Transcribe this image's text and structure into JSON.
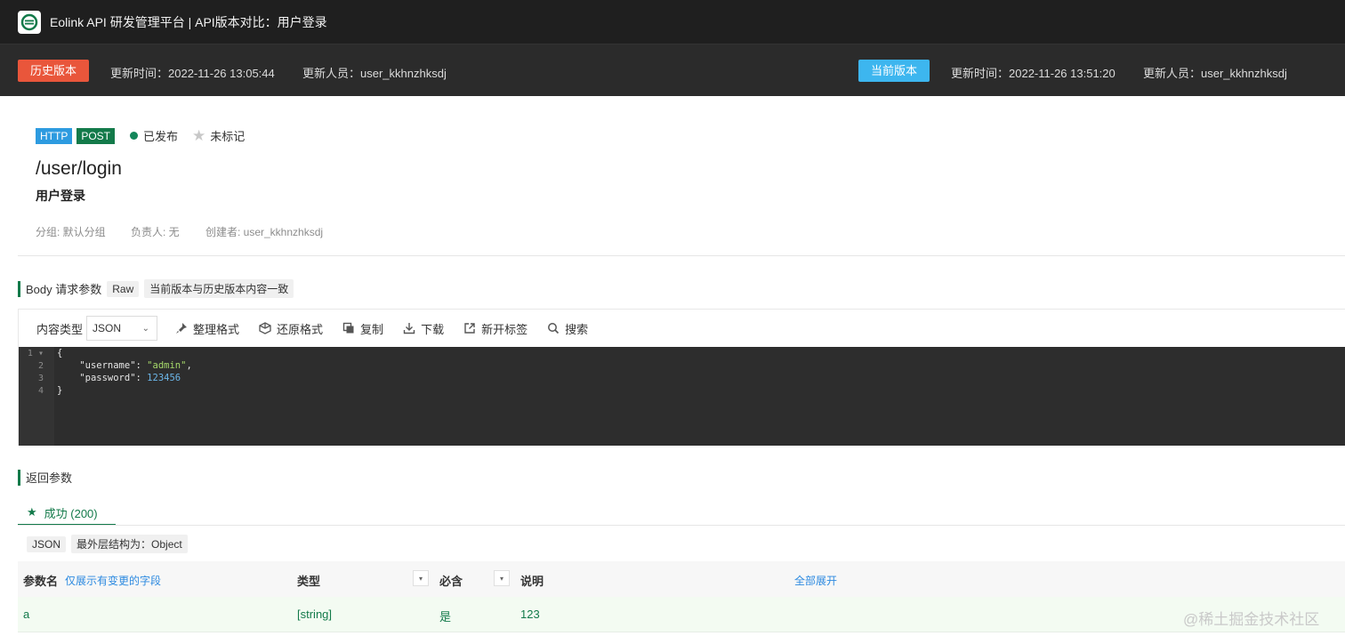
{
  "window": {
    "title": "Eolink API 研发管理平台 | API版本对比：用户登录"
  },
  "compare": {
    "history": {
      "tag": "历史版本",
      "updated_time": "更新时间：2022-11-26 13:05:44",
      "updated_by": "更新人员：user_kkhnzhksdj"
    },
    "current": {
      "tag": "当前版本",
      "updated_time": "更新时间：2022-11-26 13:51:20",
      "updated_by": "更新人员：user_kkhnzhksdj"
    }
  },
  "api": {
    "protocol": "HTTP",
    "method": "POST",
    "status": "已发布",
    "mark": "未标记",
    "path": "/user/login",
    "name": "用户登录",
    "group": "分组: 默认分组",
    "owner": "负责人: 无",
    "creator": "创建者: user_kkhnzhksdj"
  },
  "body_section": {
    "title": "Body 请求参数",
    "format_chip": "Raw",
    "compare_chip": "当前版本与历史版本内容一致"
  },
  "toolbar": {
    "content_type_label": "内容类型",
    "content_type_value": "JSON",
    "format": "整理格式",
    "restore": "还原格式",
    "copy": "复制",
    "download": "下载",
    "new_tab": "新开标签",
    "search": "搜索"
  },
  "code": {
    "lines": [
      {
        "no": "1",
        "fold": "▾",
        "text": "{"
      },
      {
        "no": "2",
        "key": "\"username\"",
        "val": "\"admin\"",
        "tail": ","
      },
      {
        "no": "3",
        "key": "\"password\"",
        "num": "123456"
      },
      {
        "no": "4",
        "text": "}"
      }
    ]
  },
  "response_section": {
    "title": "返回参数",
    "tab": "成功 (200)",
    "format_chip": "JSON",
    "structure_chip": "最外层结构为：Object"
  },
  "table": {
    "headers": {
      "name": "参数名",
      "show_changed": "仅展示有变更的字段",
      "type": "类型",
      "required": "必含",
      "description": "说明",
      "expand_all": "全部展开"
    },
    "rows": [
      {
        "name": "a",
        "type": "[string]",
        "required": "是",
        "description": "123"
      }
    ]
  },
  "watermark": "@稀土掘金技术社区",
  "colors": {
    "title_bg": "#1f1f1f",
    "compare_bg": "#2b2b2b",
    "history_tag": "#e9563b",
    "current_tag": "#3db6ef",
    "accent_green": "#137a4a",
    "http_badge": "#2d9be0",
    "code_bg": "#2d2d2d"
  }
}
